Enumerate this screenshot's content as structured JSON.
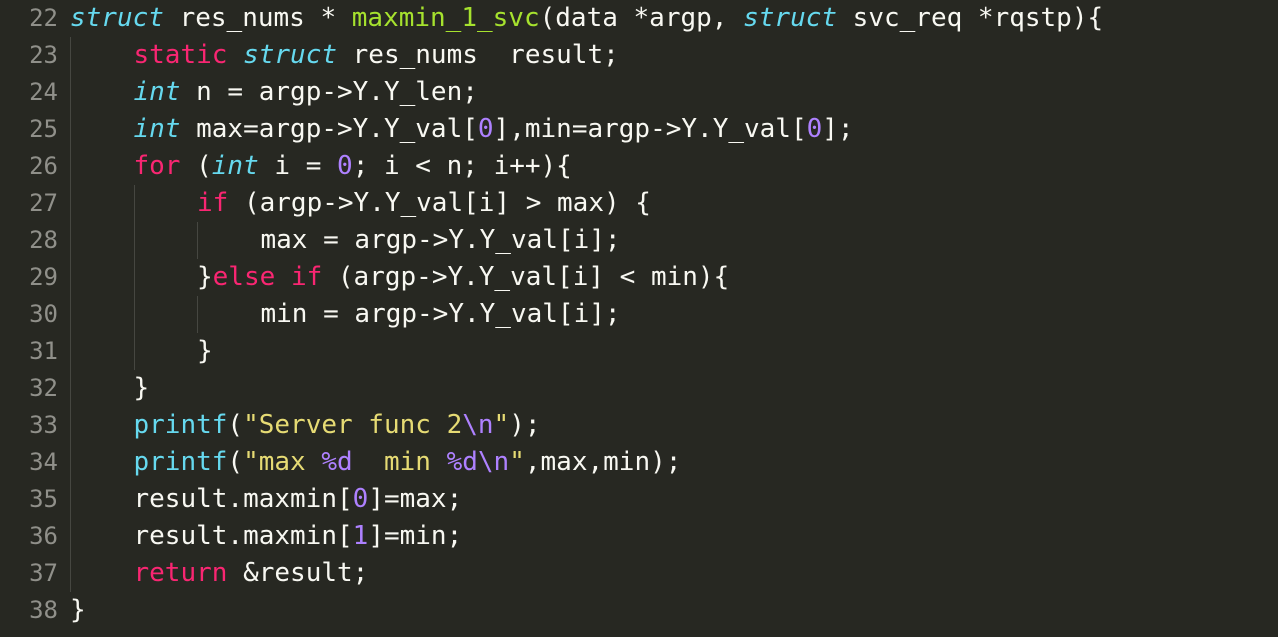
{
  "theme": {
    "background": "#272822",
    "text": "#f8f8f2",
    "gutter_text": "#90908a",
    "storage": "#66d9ef",
    "keyword": "#f92672",
    "function": "#a6e22e",
    "string": "#e6db74",
    "number": "#ae81ff"
  },
  "lines": [
    {
      "num": "22",
      "indent": 0,
      "tokens": [
        {
          "t": "struct",
          "k": "storage"
        },
        {
          "t": " res_nums * ",
          "k": "text"
        },
        {
          "t": "maxmin_1_svc",
          "k": "function"
        },
        {
          "t": "(data *argp, ",
          "k": "text"
        },
        {
          "t": "struct",
          "k": "storage"
        },
        {
          "t": " svc_req *rqstp){",
          "k": "text"
        }
      ]
    },
    {
      "num": "23",
      "indent": 1,
      "tokens": [
        {
          "t": "static",
          "k": "keyword"
        },
        {
          "t": " ",
          "k": "text"
        },
        {
          "t": "struct",
          "k": "storage"
        },
        {
          "t": " res_nums  result;",
          "k": "text"
        }
      ]
    },
    {
      "num": "24",
      "indent": 1,
      "tokens": [
        {
          "t": "int",
          "k": "storage"
        },
        {
          "t": " n = argp->Y.Y_len;",
          "k": "text"
        }
      ]
    },
    {
      "num": "25",
      "indent": 1,
      "tokens": [
        {
          "t": "int",
          "k": "storage"
        },
        {
          "t": " max=argp->Y.Y_val[",
          "k": "text"
        },
        {
          "t": "0",
          "k": "number"
        },
        {
          "t": "],min=argp->Y.Y_val[",
          "k": "text"
        },
        {
          "t": "0",
          "k": "number"
        },
        {
          "t": "];",
          "k": "text"
        }
      ]
    },
    {
      "num": "26",
      "indent": 1,
      "tokens": [
        {
          "t": "for",
          "k": "keyword"
        },
        {
          "t": " (",
          "k": "text"
        },
        {
          "t": "int",
          "k": "storage"
        },
        {
          "t": " i = ",
          "k": "text"
        },
        {
          "t": "0",
          "k": "number"
        },
        {
          "t": "; i < n; i++){",
          "k": "text"
        }
      ]
    },
    {
      "num": "27",
      "indent": 2,
      "tokens": [
        {
          "t": "if",
          "k": "keyword"
        },
        {
          "t": " (argp->Y.Y_val[i] > max) {",
          "k": "text"
        }
      ]
    },
    {
      "num": "28",
      "indent": 3,
      "tokens": [
        {
          "t": "max = argp->Y.Y_val[i];",
          "k": "text"
        }
      ]
    },
    {
      "num": "29",
      "indent": 2,
      "tokens": [
        {
          "t": "}",
          "k": "text"
        },
        {
          "t": "else",
          "k": "keyword"
        },
        {
          "t": " ",
          "k": "text"
        },
        {
          "t": "if",
          "k": "keyword"
        },
        {
          "t": " (argp->Y.Y_val[i] < min){",
          "k": "text"
        }
      ]
    },
    {
      "num": "30",
      "indent": 3,
      "tokens": [
        {
          "t": "min = argp->Y.Y_val[i];",
          "k": "text"
        }
      ]
    },
    {
      "num": "31",
      "indent": 2,
      "tokens": [
        {
          "t": "}",
          "k": "text"
        }
      ]
    },
    {
      "num": "32",
      "indent": 1,
      "tokens": [
        {
          "t": "}",
          "k": "text"
        }
      ]
    },
    {
      "num": "33",
      "indent": 1,
      "tokens": [
        {
          "t": "printf",
          "k": "support"
        },
        {
          "t": "(",
          "k": "text"
        },
        {
          "t": "\"Server func 2",
          "k": "string"
        },
        {
          "t": "\\n",
          "k": "escape"
        },
        {
          "t": "\"",
          "k": "string"
        },
        {
          "t": ");",
          "k": "text"
        }
      ]
    },
    {
      "num": "34",
      "indent": 1,
      "tokens": [
        {
          "t": "printf",
          "k": "support"
        },
        {
          "t": "(",
          "k": "text"
        },
        {
          "t": "\"max ",
          "k": "string"
        },
        {
          "t": "%d",
          "k": "escape"
        },
        {
          "t": "  min ",
          "k": "string"
        },
        {
          "t": "%d\\n",
          "k": "escape"
        },
        {
          "t": "\"",
          "k": "string"
        },
        {
          "t": ",max,min);",
          "k": "text"
        }
      ]
    },
    {
      "num": "35",
      "indent": 1,
      "tokens": [
        {
          "t": "result.maxmin[",
          "k": "text"
        },
        {
          "t": "0",
          "k": "number"
        },
        {
          "t": "]=max;",
          "k": "text"
        }
      ]
    },
    {
      "num": "36",
      "indent": 1,
      "tokens": [
        {
          "t": "result.maxmin[",
          "k": "text"
        },
        {
          "t": "1",
          "k": "number"
        },
        {
          "t": "]=min;",
          "k": "text"
        }
      ]
    },
    {
      "num": "37",
      "indent": 1,
      "tokens": [
        {
          "t": "return",
          "k": "keyword"
        },
        {
          "t": " &result;",
          "k": "text"
        }
      ]
    },
    {
      "num": "38",
      "indent": 0,
      "tokens": [
        {
          "t": "}",
          "k": "text"
        }
      ]
    }
  ]
}
